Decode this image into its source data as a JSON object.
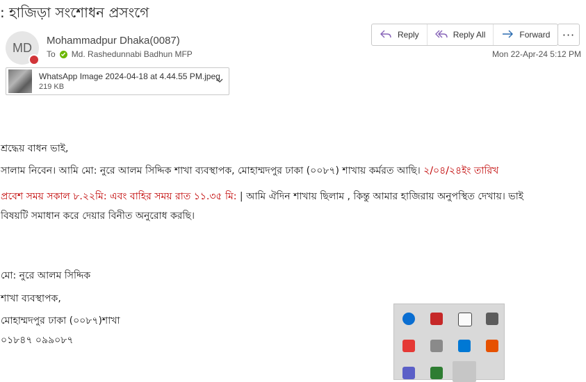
{
  "subject": ": হাজিড়া সংশোধন প্রসংগে",
  "sender": {
    "initials": "MD",
    "name": "Mohammadpur Dhaka(0087)",
    "to_label": "To",
    "recipient": "Md. Rashedunnabi Badhun MFP"
  },
  "actions": {
    "reply": "Reply",
    "reply_all": "Reply All",
    "forward": "Forward",
    "more": "···"
  },
  "date": "Mon 22-Apr-24 5:12 PM",
  "attachment": {
    "name": "WhatsApp Image 2024-04-18 at 4.44.55 PM.jpeg",
    "size": "219 KB"
  },
  "body": {
    "greeting": "শ্রদ্ধেয় বাধন ভাই,",
    "line1_a": "সালাম নিবেন। আমি মো: নুরে আলম সিদ্দিক  শাখা ব্যবস্থাপক, মোহাম্মদপুর   ঢাকা (০০৮৭) শাখায় কর্মরত আছি।",
    "line1_b": " ২/০৪/২৪ইং  তারিখ",
    "line2_a": "প্রবেশ সময় সকাল ৮.২২মি: এবং বাহির সময়  রাত ১১.৩৫ মি:",
    "line2_b": " |  আমি ঐদিন শাখায় ছিলাম ,  কিন্তু আমার হাজিরায় অনুপস্থিত দেখায়। ভাই",
    "line3": "বিষয়টি সমাধান করে দেয়ার বিনীত অনুরোধ করছি।",
    "sig_name": "মো: নুরে আলম সিদ্দিক",
    "sig_title": " শাখা ব্যবস্থাপক,",
    "sig_branch": "মোহাম্মদপুর   ঢাকা (০০৮৭)শাখা",
    "sig_phone": "০১৮৪৭ ০৯৯০৮৭"
  },
  "tray_icons": [
    "bluetooth-icon",
    "shield-red-icon",
    "defender-icon",
    "security-app-icon",
    "anydesk-icon",
    "onedrive-icon",
    "outlook-icon",
    "bijoy-icon",
    "teams-icon",
    "app-icon",
    "pen-icon"
  ]
}
